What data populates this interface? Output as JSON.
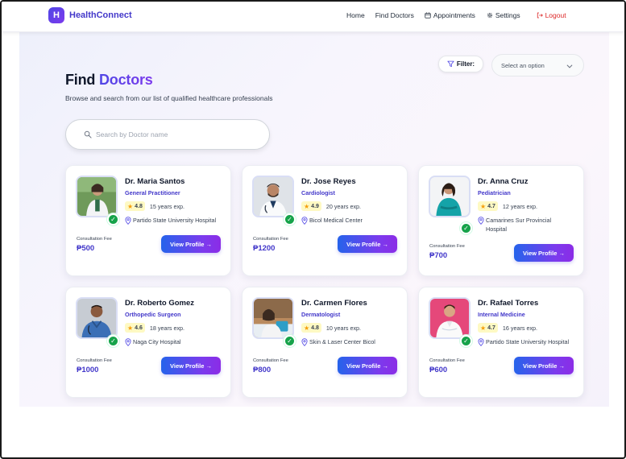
{
  "nav": {
    "brand_letter": "H",
    "brand_name": "HealthConnect",
    "links": {
      "home": "Home",
      "find_doctors": "Find Doctors",
      "appointments": "Appointments",
      "settings": "Settings",
      "logout": "Logout"
    }
  },
  "page": {
    "title_part1": "Find",
    "title_part2": "Doctors",
    "subtitle": "Browse and search from our list of qualified healthcare professionals"
  },
  "filter": {
    "label": "Filter:",
    "select_placeholder": "Select an option"
  },
  "search": {
    "placeholder": "Search by Doctor name",
    "value": ""
  },
  "fee_label": "Consultation Fee",
  "view_profile_label": "View Profile →",
  "doctors": [
    {
      "name": "Dr. Maria Santos",
      "specialty": "General Practitioner",
      "rating": "4.8",
      "experience": "15 years exp.",
      "location": "Partido State University Hospital",
      "fee": "₱500"
    },
    {
      "name": "Dr. Jose Reyes",
      "specialty": "Cardiologist",
      "rating": "4.9",
      "experience": "20 years exp.",
      "location": "Bicol Medical Center",
      "fee": "₱1200"
    },
    {
      "name": "Dr. Anna Cruz",
      "specialty": "Pediatrician",
      "rating": "4.7",
      "experience": "12 years exp.",
      "location": "Camarines Sur Provincial Hospital",
      "fee": "₱700"
    },
    {
      "name": "Dr. Roberto Gomez",
      "specialty": "Orthopedic Surgeon",
      "rating": "4.6",
      "experience": "18 years exp.",
      "location": "Naga City Hospital",
      "fee": "₱1000"
    },
    {
      "name": "Dr. Carmen Flores",
      "specialty": "Dermatologist",
      "rating": "4.8",
      "experience": "10 years exp.",
      "location": "Skin & Laser Center Bicol",
      "fee": "₱800"
    },
    {
      "name": "Dr. Rafael Torres",
      "specialty": "Internal Medicine",
      "rating": "4.7",
      "experience": "16 years exp.",
      "location": "Partido State University Hospital",
      "fee": "₱600"
    }
  ],
  "colors": {
    "accent": "#4f46e5",
    "accent_purple": "#7c3aed",
    "verified": "#16a34a",
    "logout": "#dc2626",
    "star": "#f59e0b"
  }
}
